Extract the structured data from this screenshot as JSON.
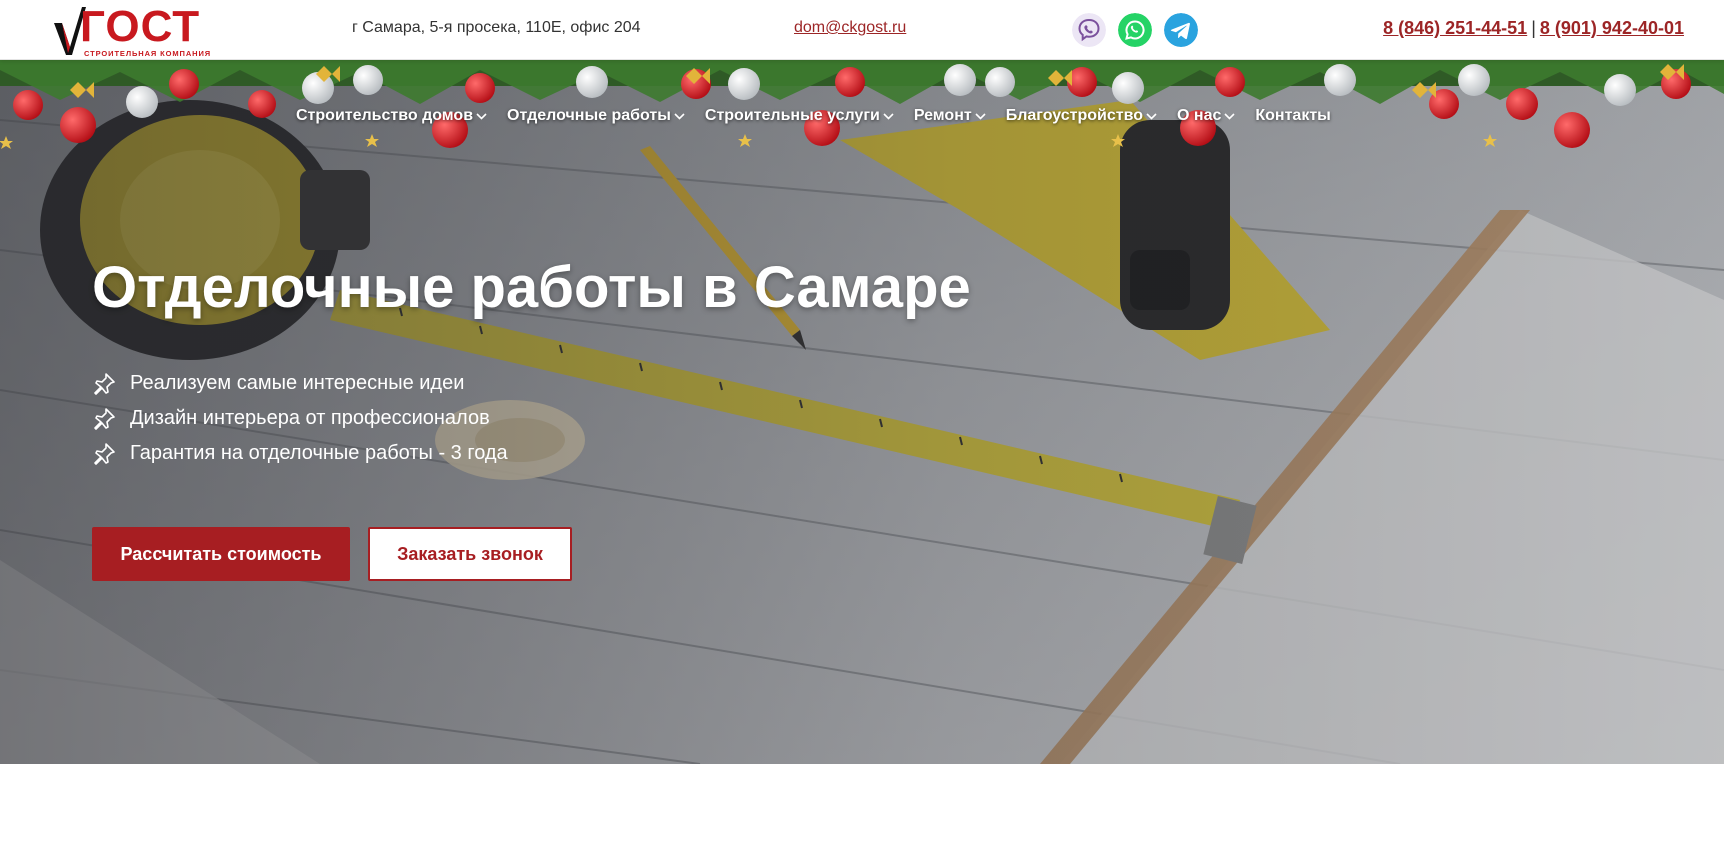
{
  "header": {
    "logo": {
      "name": "ГОСТ",
      "subtitle": "СТРОИТЕЛЬНАЯ КОМПАНИЯ"
    },
    "address": "г Самара, 5-я просека, 110Е, офис 204",
    "email": "dom@ckgost.ru",
    "messengers": [
      {
        "icon": "viber-icon",
        "color": "#7b519d"
      },
      {
        "icon": "whatsapp-icon",
        "color": "#25d366"
      },
      {
        "icon": "telegram-icon",
        "color": "#2aa3df"
      }
    ],
    "phones": [
      "8 (846) 251-44-51",
      "8 (901) 942-40-01"
    ],
    "phone_separator": "|"
  },
  "nav": {
    "items": [
      {
        "label": "Строительство домов",
        "has_dropdown": true
      },
      {
        "label": "Отделочные работы",
        "has_dropdown": true
      },
      {
        "label": "Строительные услуги",
        "has_dropdown": true
      },
      {
        "label": "Ремонт",
        "has_dropdown": true
      },
      {
        "label": "Благоустройство",
        "has_dropdown": true
      },
      {
        "label": "О нас",
        "has_dropdown": true
      },
      {
        "label": "Контакты",
        "has_dropdown": false
      }
    ]
  },
  "hero": {
    "title": "Отделочные работы в Самаре",
    "features": [
      "Реализуем самые интересные идеи",
      "Дизайн интерьера от профессионалов",
      "Гарантия на отделочные работы - 3 года"
    ],
    "feature_icon": "pushpin-icon",
    "primary_button": "Рассчитать стоимость",
    "secondary_button": "Заказать звонок"
  },
  "colors": {
    "brand_red": "#a71e22",
    "logo_red": "#c8191f",
    "link_red": "#9c2526"
  }
}
